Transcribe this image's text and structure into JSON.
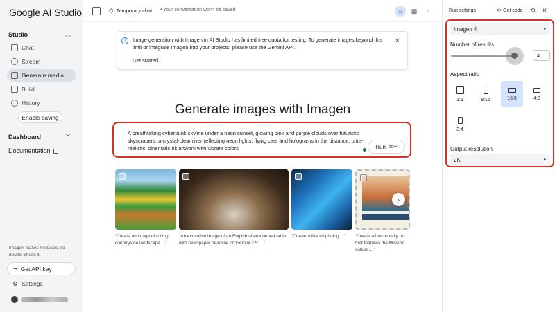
{
  "app": {
    "brand": "Google AI Studio"
  },
  "sidebar": {
    "studio_label": "Studio",
    "items": [
      {
        "label": "Chat",
        "icon": "chat-icon"
      },
      {
        "label": "Stream",
        "icon": "stream-icon"
      },
      {
        "label": "Generate media",
        "icon": "image-icon",
        "active": true
      },
      {
        "label": "Build",
        "icon": "build-icon"
      },
      {
        "label": "History",
        "icon": "history-icon"
      }
    ],
    "enable_saving": "Enable saving",
    "dashboard_label": "Dashboard",
    "documentation_label": "Documentation",
    "note": "Imagen makes mistakes, so double-check it.",
    "api_key_label": "Get API key",
    "settings_label": "Settings"
  },
  "topbar": {
    "title": "Temporary chat",
    "note": "Your conversation won't be saved"
  },
  "banner": {
    "text": "Image generation with Imagen in AI Studio has limited free quota for testing. To generate images beyond this limit or integrate Imagen into your projects, please use the Gemini API.",
    "link": "Get started"
  },
  "main": {
    "heading": "Generate images with Imagen",
    "prompt": "A breathtaking cyberpunk skyline under a neon sunset, glowing pink and purple clouds over futuristic skyscrapers, a crystal-clear river reflecting neon lights, flying cars and holograms in the distance, ultra-realistic, cinematic 8k artwork with vibrant colors",
    "run_label": "Run",
    "run_shortcut": "⌘↩"
  },
  "gallery": [
    {
      "caption": "“Create an image of rolling countryside landscape... ”"
    },
    {
      "caption": "“An evocative image of an English afternoon tea table with newspaper headline of 'Gemini 2.5' ...”"
    },
    {
      "caption": "“Create a Macro photog... ”"
    },
    {
      "caption": "“Create a horizontally ori... that features the Mission culture... ”"
    }
  ],
  "right_panel": {
    "title": "Run settings",
    "get_code": "Get code",
    "model": "Imagen 4",
    "num_results_label": "Number of results",
    "num_results": "4",
    "aspect_label": "Aspect ratio",
    "aspects": [
      "1:1",
      "9:16",
      "16:9",
      "4:3",
      "3:4"
    ],
    "aspect_selected": "16:9",
    "output_label": "Output resolution",
    "output_value": "2K"
  },
  "colors": {
    "highlight": "#d93025",
    "active_nav": "#dde0e6",
    "aspect_active": "#d3e3fd"
  }
}
